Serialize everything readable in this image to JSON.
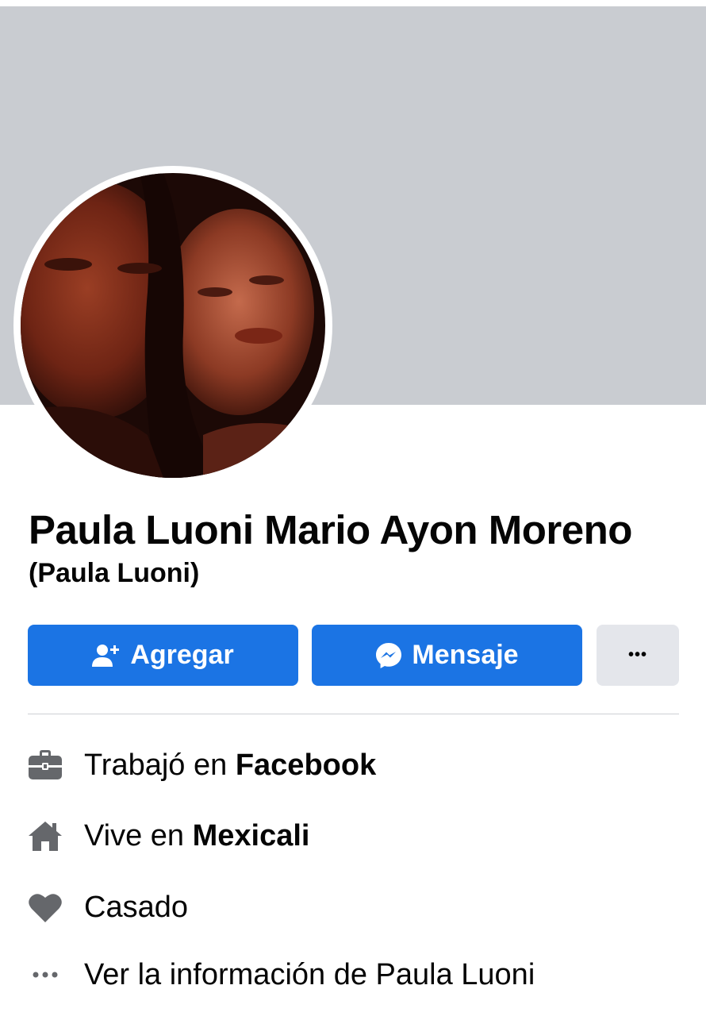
{
  "profile": {
    "name": "Paula Luoni Mario Ayon Moreno",
    "alternate_name": "(Paula Luoni)"
  },
  "actions": {
    "add_label": "Agregar",
    "message_label": "Mensaje",
    "more_label": "•••"
  },
  "details": {
    "work_prefix": "Trabajó en ",
    "work_place": "Facebook",
    "lives_prefix": "Vive en ",
    "lives_place": "Mexicali",
    "relationship": "Casado",
    "see_about": "Ver la información de Paula Luoni"
  },
  "colors": {
    "primary": "#1b74e4",
    "cover": "#c9ccd1",
    "secondary_button": "#e4e6eb",
    "icon": "#65676b"
  },
  "icons": {
    "work": "briefcase-icon",
    "home": "house-icon",
    "relationship": "heart-icon",
    "more": "ellipsis-icon",
    "add_friend": "add-friend-icon",
    "messenger": "messenger-icon"
  }
}
